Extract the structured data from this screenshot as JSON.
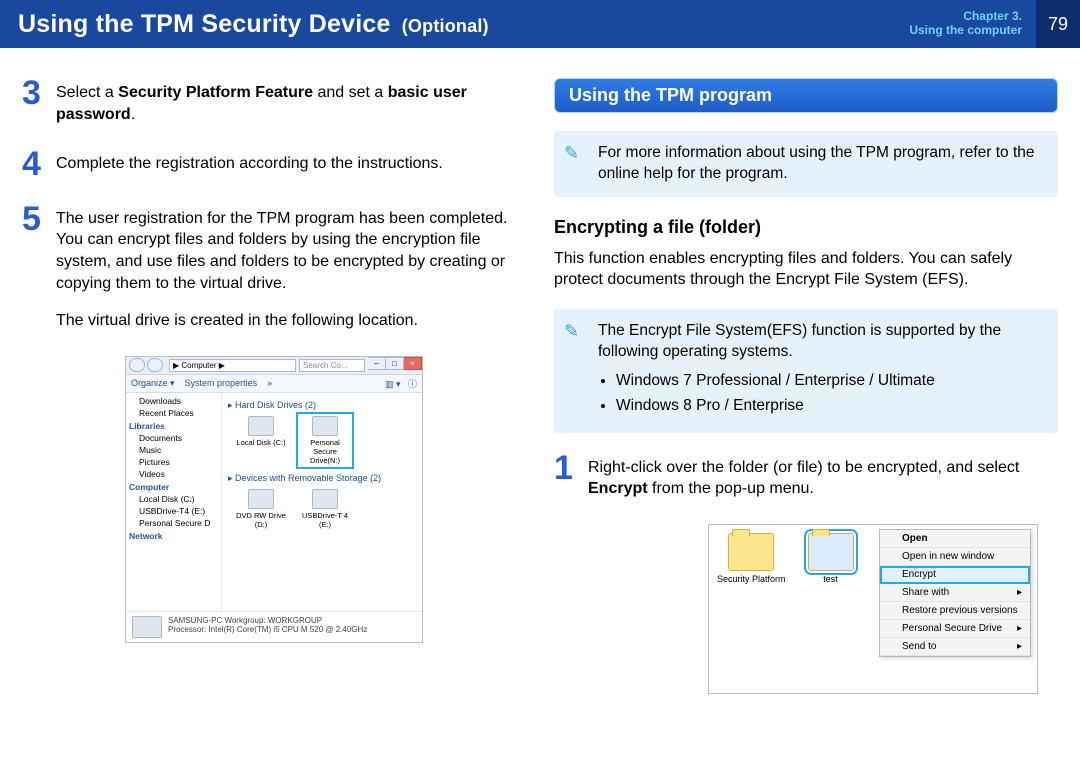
{
  "header": {
    "title": "Using the TPM Security Device",
    "optional": "(Optional)",
    "chapter_line1": "Chapter 3.",
    "chapter_line2": "Using the computer",
    "page": "79"
  },
  "left": {
    "steps": [
      {
        "num": "3",
        "body_html": "Select a <b>Security Platform Feature</b> and set a <b>basic user password</b>."
      },
      {
        "num": "4",
        "body_html": "Complete the registration according to the instructions."
      },
      {
        "num": "5",
        "body_html": "The user registration for the TPM program has been completed. You can encrypt files and folders by using the encryption file system, and use files and folders to be encrypted by creating or copying them to the virtual drive.",
        "extra": "The virtual drive is created in the following location."
      }
    ],
    "explorer": {
      "address": "▶ Computer ▶",
      "search_placeholder": "Search Co...",
      "toolbar": {
        "organize": "Organize ▾",
        "properties": "System properties",
        "more": "»"
      },
      "side": {
        "downloads": "Downloads",
        "recent": "Recent Places",
        "libraries": "Libraries",
        "documents": "Documents",
        "music": "Music",
        "pictures": "Pictures",
        "videos": "Videos",
        "computer": "Computer",
        "localdisk": "Local Disk (C:)",
        "usbdrive": "USBDrive-T4 (E:)",
        "psd": "Personal Secure D",
        "network": "Network"
      },
      "main": {
        "group1": "▸ Hard Disk Drives (2)",
        "drive1": "Local Disk (C:)",
        "drive2": "Personal Secure Drive(N:)",
        "group2": "▸ Devices with Removable Storage (2)",
        "drive3": "DVD RW Drive (D:)",
        "drive4": "USBDrive-T 4 (E:)"
      },
      "details": {
        "line1": "SAMSUNG-PC   Workgroup: WORKGROUP",
        "line2": "Processor: Intel(R) Core(TM) i5 CPU     M 520 @ 2.40GHz"
      }
    }
  },
  "right": {
    "section_title": "Using the TPM program",
    "note1": "For more information about using the TPM program, refer to the online help for the program.",
    "subhead": "Encrypting a file (folder)",
    "para": "This function enables encrypting files and folders. You can safely protect documents through the Encrypt File System (EFS).",
    "note2_intro": "The Encrypt File System(EFS) function is supported by the following operating systems.",
    "note2_items": [
      "Windows 7 Professional / Enterprise / Ultimate",
      "Windows 8 Pro / Enterprise"
    ],
    "step1": {
      "num": "1",
      "body_html": "Right-click over the folder (or file) to be encrypted, and select <b>Encrypt</b> from the pop-up menu."
    },
    "ctx": {
      "folder1": "Security Platform",
      "folder2": "test",
      "menu": [
        "Open",
        "Open in new window",
        "Encrypt",
        "Share with",
        "Restore previous versions",
        "Personal Secure Drive",
        "Send to"
      ]
    }
  }
}
